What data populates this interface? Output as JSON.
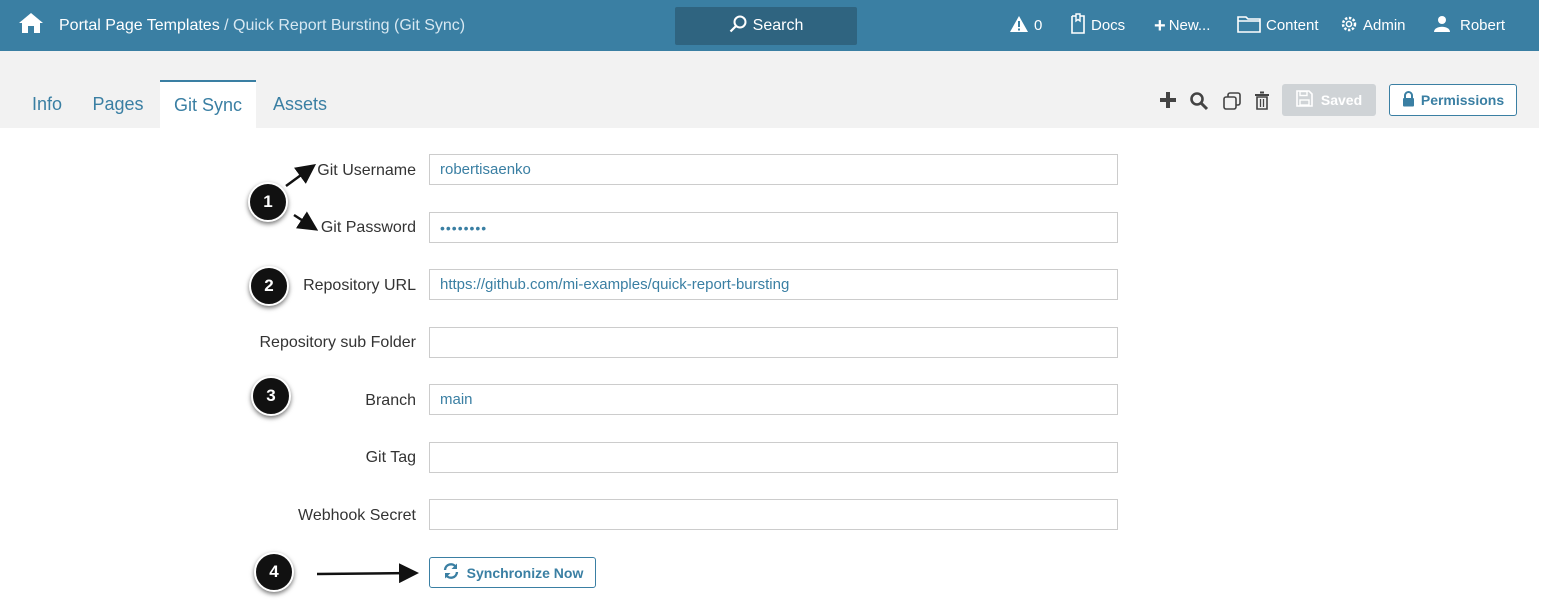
{
  "header": {
    "breadcrumb_root": "Portal Page Templates",
    "breadcrumb_separator": " / ",
    "breadcrumb_current": "Quick Report Bursting (Git Sync)",
    "search_label": "Search",
    "alert_count": "0",
    "docs_label": "Docs",
    "new_label": "New...",
    "content_label": "Content",
    "admin_label": "Admin",
    "user_label": "Robert"
  },
  "tabs": [
    {
      "label": "Info"
    },
    {
      "label": "Pages"
    },
    {
      "label": "Git Sync",
      "active": true
    },
    {
      "label": "Assets"
    }
  ],
  "toolbar": {
    "saved_label": "Saved",
    "permissions_label": "Permissions"
  },
  "form": {
    "git_username": {
      "label": "Git Username",
      "value": "robertisaenko"
    },
    "git_password": {
      "label": "Git Password",
      "value": "••••••••"
    },
    "repository_url": {
      "label": "Repository URL",
      "value": "https://github.com/mi-examples/quick-report-bursting"
    },
    "repository_sub_folder": {
      "label": "Repository sub Folder",
      "value": ""
    },
    "branch": {
      "label": "Branch",
      "value": "main"
    },
    "git_tag": {
      "label": "Git Tag",
      "value": ""
    },
    "webhook_secret": {
      "label": "Webhook Secret",
      "value": ""
    },
    "sync_button_label": "Synchronize Now"
  },
  "callouts": [
    "1",
    "2",
    "3",
    "4"
  ],
  "colors": {
    "accent": "#3a7fa3",
    "header_bg": "#3a7fa3",
    "search_bg": "#2f6480",
    "saved_bg": "#cfd3d6",
    "badge": "#111111"
  }
}
